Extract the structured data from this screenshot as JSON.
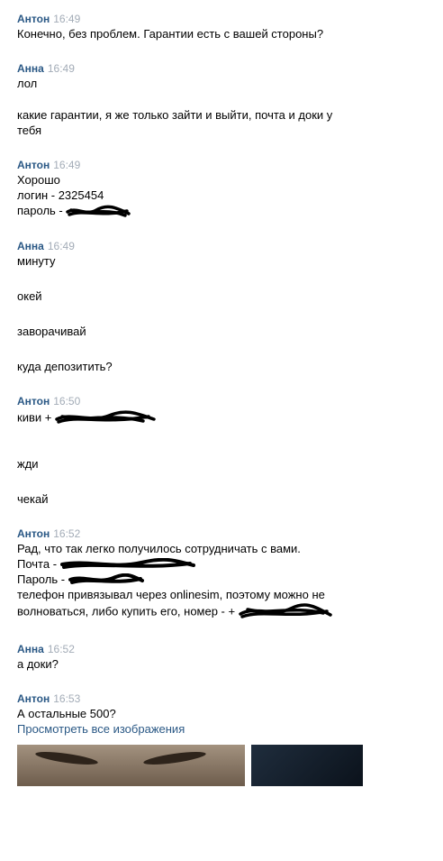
{
  "messages": [
    {
      "author": "Антон",
      "time": "16:49",
      "lines": [
        "Конечно, без проблем. Гарантии есть с вашей стороны?"
      ]
    },
    {
      "author": "Анна",
      "time": "16:49",
      "lines": [
        "лол",
        "какие гарантии, я же только зайти и выйти, почта и доки у",
        "тебя"
      ]
    },
    {
      "author": "Антон",
      "time": "16:49",
      "lines": [
        "Хорошо",
        "логин - 2325454",
        "пароль -"
      ]
    },
    {
      "author": "Анна",
      "time": "16:49",
      "lines": [
        "минуту",
        "окей",
        "заворачивай",
        "куда депозитить?"
      ]
    },
    {
      "author": "Антон",
      "time": "16:50",
      "lines": [
        "киви +",
        "жди",
        "чекай"
      ]
    },
    {
      "author": "Антон",
      "time": "16:52",
      "lines": [
        "Рад, что так легко получилось сотрудничать с вами.",
        "Почта -",
        "Пароль -",
        "телефон привязывал через onlinesim, поэтому можно не",
        "волноваться, либо купить его, номер - +"
      ]
    },
    {
      "author": "Анна",
      "time": "16:52",
      "lines": [
        "а доки?"
      ]
    },
    {
      "author": "Антон",
      "time": "16:53",
      "lines": [
        "А остальные 500?"
      ],
      "link": "Просмотреть все изображения"
    }
  ]
}
